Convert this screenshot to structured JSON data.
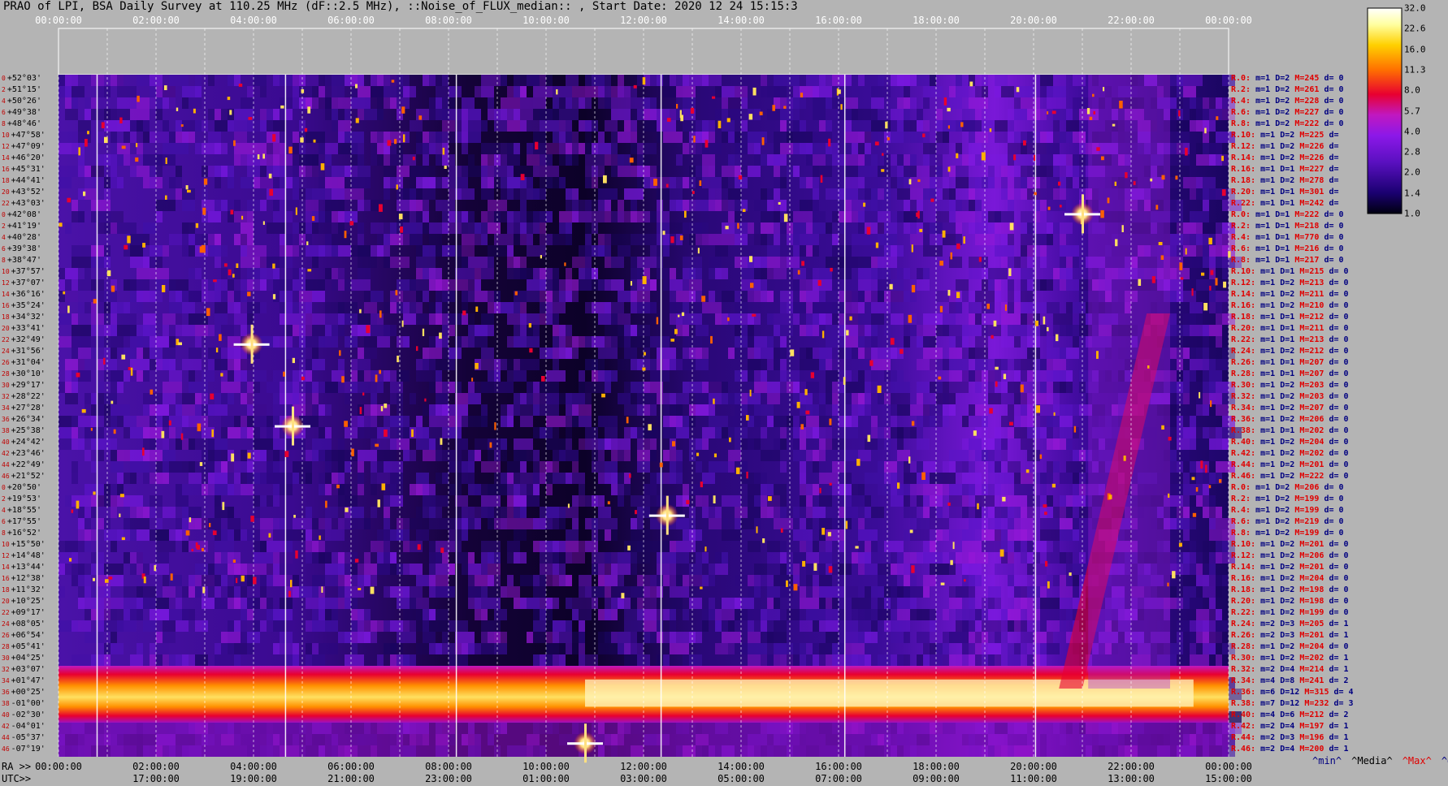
{
  "title": "PRAO of LPI, BSA Daily Survey at 110.25 MHz (dF::2.5 MHz), ::Noise_of_FLUX_median:: , Start Date: 2020 12 24 15:15:3",
  "chart_data": {
    "type": "heatmap",
    "title": "PRAO of LPI, BSA Daily Survey at 110.25 MHz (dF::2.5 MHz), ::Noise_of_FLUX_median:: , Start Date: 2020 12 24 15:15:3",
    "x_top_ticks": [
      "00:00:00",
      "02:00:00",
      "04:00:00",
      "06:00:00",
      "08:00:00",
      "10:00:00",
      "12:00:00",
      "14:00:00",
      "16:00:00",
      "18:00:00",
      "20:00:00",
      "22:00:00",
      "00:00:00"
    ],
    "ra_axis_label": "RA >>",
    "ra_ticks": [
      "00:00:00",
      "02:00:00",
      "04:00:00",
      "06:00:00",
      "08:00:00",
      "10:00:00",
      "12:00:00",
      "14:00:00",
      "16:00:00",
      "18:00:00",
      "20:00:00",
      "22:00:00",
      "00:00:00"
    ],
    "utc_axis_label": "UTC>>",
    "utc_ticks": [
      "17:00:00",
      "19:00:00",
      "21:00:00",
      "23:00:00",
      "01:00:00",
      "03:00:00",
      "05:00:00",
      "07:00:00",
      "09:00:00",
      "11:00:00",
      "13:00:00",
      "15:00:00"
    ],
    "colorbar": {
      "ticks": [
        "32.0",
        "22.6",
        "16.0",
        "11.3",
        "8.0",
        "5.7",
        "4.0",
        "2.8",
        "2.0",
        "1.4",
        "1.0"
      ],
      "scale": "log",
      "range": [
        1.0,
        32.0
      ],
      "colormap": [
        "#000010",
        "#1a0070",
        "#5a10c0",
        "#8c18e8",
        "#c018c0",
        "#e80030",
        "#ff7000",
        "#ffd000",
        "#ffffa0",
        "#ffffff"
      ]
    },
    "declinations": [
      "+52°03'",
      "+51°15'",
      "+50°26'",
      "+49°38'",
      "+48°46'",
      "+47°58'",
      "+47°09'",
      "+46°20'",
      "+45°31'",
      "+44°41'",
      "+43°52'",
      "+43°03'",
      "+42°08'",
      "+41°19'",
      "+40°28'",
      "+39°38'",
      "+38°47'",
      "+37°57'",
      "+37°07'",
      "+36°16'",
      "+35°24'",
      "+34°32'",
      "+33°41'",
      "+32°49'",
      "+31°56'",
      "+31°04'",
      "+30°10'",
      "+29°17'",
      "+28°22'",
      "+27°28'",
      "+26°34'",
      "+25°38'",
      "+24°42'",
      "+23°46'",
      "+22°49'",
      "+21°52'",
      "+20°50'",
      "+19°53'",
      "+18°55'",
      "+17°55'",
      "+16°52'",
      "+15°50'",
      "+14°48'",
      "+13°44'",
      "+12°38'",
      "+11°32'",
      "+10°25'",
      "+09°17'",
      "+08°05'",
      "+06°54'",
      "+05°41'",
      "+04°25'",
      "+03°07'",
      "+01°47'",
      "+00°25'",
      "-01°00'",
      "-02°30'",
      "-04°01'",
      "-05°37'",
      "-07°19'"
    ],
    "row_indices": [
      "0",
      "2",
      "4",
      "6",
      "8",
      "10",
      "12",
      "14",
      "16",
      "18",
      "20",
      "22",
      "0",
      "2",
      "4",
      "6",
      "8",
      "10",
      "12",
      "14",
      "16",
      "18",
      "20",
      "22",
      "24",
      "26",
      "28",
      "30",
      "32",
      "34",
      "36",
      "38",
      "40",
      "42",
      "44",
      "46",
      "0",
      "2",
      "4",
      "6",
      "8",
      "10",
      "12",
      "14",
      "16",
      "18",
      "20",
      "22",
      "24",
      "26",
      "28",
      "30",
      "32",
      "34",
      "36",
      "38",
      "40",
      "42",
      "44",
      "46"
    ],
    "row_stats": [
      {
        "r": "R.0:",
        "m": "m=1",
        "d": "D=2",
        "mx": "M=245",
        "dv": "d= 0"
      },
      {
        "r": "R.2:",
        "m": "m=1",
        "d": "D=2",
        "mx": "M=261",
        "dv": "d= 0"
      },
      {
        "r": "R.4:",
        "m": "m=1",
        "d": "D=2",
        "mx": "M=228",
        "dv": "d= 0"
      },
      {
        "r": "R.6:",
        "m": "m=1",
        "d": "D=2",
        "mx": "M=227",
        "dv": "d= 0"
      },
      {
        "r": "R.8:",
        "m": "m=1",
        "d": "D=2",
        "mx": "M=222",
        "dv": "d= 0"
      },
      {
        "r": "R.10:",
        "m": "m=1",
        "d": "D=2",
        "mx": "M=225",
        "dv": "d="
      },
      {
        "r": "R.12:",
        "m": "m=1",
        "d": "D=2",
        "mx": "M=226",
        "dv": "d="
      },
      {
        "r": "R.14:",
        "m": "m=1",
        "d": "D=2",
        "mx": "M=226",
        "dv": "d="
      },
      {
        "r": "R.16:",
        "m": "m=1",
        "d": "D=1",
        "mx": "M=227",
        "dv": "d="
      },
      {
        "r": "R.18:",
        "m": "m=1",
        "d": "D=2",
        "mx": "M=278",
        "dv": "d="
      },
      {
        "r": "R.20:",
        "m": "m=1",
        "d": "D=1",
        "mx": "M=301",
        "dv": "d="
      },
      {
        "r": "R.22:",
        "m": "m=1",
        "d": "D=1",
        "mx": "M=242",
        "dv": "d="
      },
      {
        "r": "R.0:",
        "m": "m=1",
        "d": "D=1",
        "mx": "M=222",
        "dv": "d= 0"
      },
      {
        "r": "R.2:",
        "m": "m=1",
        "d": "D=1",
        "mx": "M=218",
        "dv": "d= 0"
      },
      {
        "r": "R.4:",
        "m": "m=1",
        "d": "D=1",
        "mx": "M=770",
        "dv": "d= 0"
      },
      {
        "r": "R.6:",
        "m": "m=1",
        "d": "D=1",
        "mx": "M=216",
        "dv": "d= 0"
      },
      {
        "r": "R.8:",
        "m": "m=1",
        "d": "D=1",
        "mx": "M=217",
        "dv": "d= 0"
      },
      {
        "r": "R.10:",
        "m": "m=1",
        "d": "D=1",
        "mx": "M=215",
        "dv": "d= 0"
      },
      {
        "r": "R.12:",
        "m": "m=1",
        "d": "D=2",
        "mx": "M=213",
        "dv": "d= 0"
      },
      {
        "r": "R.14:",
        "m": "m=1",
        "d": "D=2",
        "mx": "M=211",
        "dv": "d= 0"
      },
      {
        "r": "R.16:",
        "m": "m=1",
        "d": "D=2",
        "mx": "M=210",
        "dv": "d= 0"
      },
      {
        "r": "R.18:",
        "m": "m=1",
        "d": "D=1",
        "mx": "M=212",
        "dv": "d= 0"
      },
      {
        "r": "R.20:",
        "m": "m=1",
        "d": "D=1",
        "mx": "M=211",
        "dv": "d= 0"
      },
      {
        "r": "R.22:",
        "m": "m=1",
        "d": "D=1",
        "mx": "M=213",
        "dv": "d= 0"
      },
      {
        "r": "R.24:",
        "m": "m=1",
        "d": "D=2",
        "mx": "M=212",
        "dv": "d= 0"
      },
      {
        "r": "R.26:",
        "m": "m=1",
        "d": "D=1",
        "mx": "M=207",
        "dv": "d= 0"
      },
      {
        "r": "R.28:",
        "m": "m=1",
        "d": "D=1",
        "mx": "M=207",
        "dv": "d= 0"
      },
      {
        "r": "R.30:",
        "m": "m=1",
        "d": "D=2",
        "mx": "M=203",
        "dv": "d= 0"
      },
      {
        "r": "R.32:",
        "m": "m=1",
        "d": "D=2",
        "mx": "M=203",
        "dv": "d= 0"
      },
      {
        "r": "R.34:",
        "m": "m=1",
        "d": "D=2",
        "mx": "M=207",
        "dv": "d= 0"
      },
      {
        "r": "R.36:",
        "m": "m=1",
        "d": "D=2",
        "mx": "M=206",
        "dv": "d= 0"
      },
      {
        "r": "R.38:",
        "m": "m=1",
        "d": "D=1",
        "mx": "M=202",
        "dv": "d= 0"
      },
      {
        "r": "R.40:",
        "m": "m=1",
        "d": "D=2",
        "mx": "M=204",
        "dv": "d= 0"
      },
      {
        "r": "R.42:",
        "m": "m=1",
        "d": "D=2",
        "mx": "M=202",
        "dv": "d= 0"
      },
      {
        "r": "R.44:",
        "m": "m=1",
        "d": "D=2",
        "mx": "M=201",
        "dv": "d= 0"
      },
      {
        "r": "R.46:",
        "m": "m=1",
        "d": "D=2",
        "mx": "M=222",
        "dv": "d= 0"
      },
      {
        "r": "R.0:",
        "m": "m=1",
        "d": "D=2",
        "mx": "M=206",
        "dv": "d= 0"
      },
      {
        "r": "R.2:",
        "m": "m=1",
        "d": "D=2",
        "mx": "M=199",
        "dv": "d= 0"
      },
      {
        "r": "R.4:",
        "m": "m=1",
        "d": "D=2",
        "mx": "M=199",
        "dv": "d= 0"
      },
      {
        "r": "R.6:",
        "m": "m=1",
        "d": "D=2",
        "mx": "M=219",
        "dv": "d= 0"
      },
      {
        "r": "R.8:",
        "m": "m=1",
        "d": "D=2",
        "mx": "M=199",
        "dv": "d= 0"
      },
      {
        "r": "R.10:",
        "m": "m=1",
        "d": "D=2",
        "mx": "M=201",
        "dv": "d= 0"
      },
      {
        "r": "R.12:",
        "m": "m=1",
        "d": "D=2",
        "mx": "M=206",
        "dv": "d= 0"
      },
      {
        "r": "R.14:",
        "m": "m=1",
        "d": "D=2",
        "mx": "M=201",
        "dv": "d= 0"
      },
      {
        "r": "R.16:",
        "m": "m=1",
        "d": "D=2",
        "mx": "M=204",
        "dv": "d= 0"
      },
      {
        "r": "R.18:",
        "m": "m=1",
        "d": "D=2",
        "mx": "M=198",
        "dv": "d= 0"
      },
      {
        "r": "R.20:",
        "m": "m=1",
        "d": "D=2",
        "mx": "M=198",
        "dv": "d= 0"
      },
      {
        "r": "R.22:",
        "m": "m=1",
        "d": "D=2",
        "mx": "M=199",
        "dv": "d= 0"
      },
      {
        "r": "R.24:",
        "m": "m=2",
        "d": "D=3",
        "mx": "M=205",
        "dv": "d= 1"
      },
      {
        "r": "R.26:",
        "m": "m=2",
        "d": "D=3",
        "mx": "M=201",
        "dv": "d= 1"
      },
      {
        "r": "R.28:",
        "m": "m=1",
        "d": "D=2",
        "mx": "M=204",
        "dv": "d= 0"
      },
      {
        "r": "R.30:",
        "m": "m=1",
        "d": "D=2",
        "mx": "M=202",
        "dv": "d= 1"
      },
      {
        "r": "R.32:",
        "m": "m=2",
        "d": "D=4",
        "mx": "M=214",
        "dv": "d= 1"
      },
      {
        "r": "R.34:",
        "m": "m=4",
        "d": "D=8",
        "mx": "M=241",
        "dv": "d= 2"
      },
      {
        "r": "R.36:",
        "m": "m=6",
        "d": "D=12",
        "mx": "M=315",
        "dv": "d= 4"
      },
      {
        "r": "R.38:",
        "m": "m=7",
        "d": "D=12",
        "mx": "M=232",
        "dv": "d= 3"
      },
      {
        "r": "R.40:",
        "m": "m=4",
        "d": "D=6",
        "mx": "M=212",
        "dv": "d= 2"
      },
      {
        "r": "R.42:",
        "m": "m=2",
        "d": "D=4",
        "mx": "M=197",
        "dv": "d= 1"
      },
      {
        "r": "R.44:",
        "m": "m=2",
        "d": "D=3",
        "mx": "M=196",
        "dv": "d= 1"
      },
      {
        "r": "R.46:",
        "m": "m=2",
        "d": "D=4",
        "mx": "M=200",
        "dv": "d= 1"
      }
    ],
    "legend_items": [
      {
        "label": "^min^",
        "color": "#000080"
      },
      {
        "label": "^Media^",
        "color": "#000000"
      },
      {
        "label": "^Max^",
        "color": "#e00000"
      },
      {
        "label": "^devia^",
        "color": "#000080"
      }
    ]
  }
}
